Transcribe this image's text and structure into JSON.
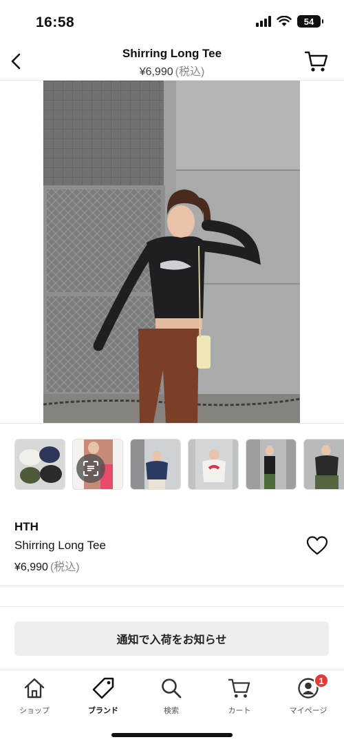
{
  "status": {
    "time": "16:58",
    "battery": "54"
  },
  "header": {
    "title": "Shirring Long Tee",
    "price": "¥6,990",
    "tax": "(税込)"
  },
  "product": {
    "brand": "HTH",
    "name": "Shirring Long Tee",
    "price": "¥6,990",
    "tax": "(税込)"
  },
  "notify_button": "通知で入荷をお知らせ",
  "tabs": [
    {
      "label": "ショップ",
      "icon": "home-icon"
    },
    {
      "label": "ブランド",
      "icon": "tag-icon"
    },
    {
      "label": "検索",
      "icon": "search-icon"
    },
    {
      "label": "カート",
      "icon": "cart-icon"
    },
    {
      "label": "マイページ",
      "icon": "user-icon",
      "badge": "1"
    }
  ],
  "colors": {
    "badge": "#e53935",
    "button_bg": "#eeeeee"
  }
}
